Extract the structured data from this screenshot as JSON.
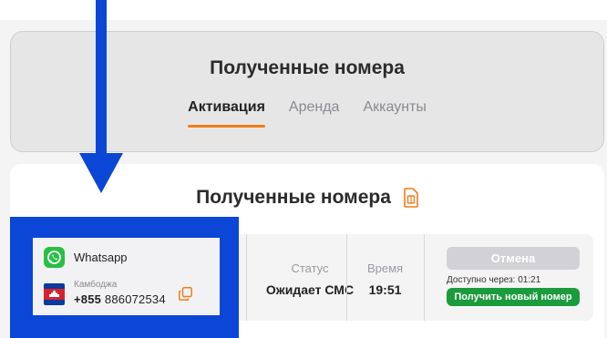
{
  "header": {
    "title": "Полученные номера",
    "tabs": [
      {
        "label": "Активация",
        "active": true
      },
      {
        "label": "Аренда",
        "active": false
      },
      {
        "label": "Аккаунты",
        "active": false
      }
    ]
  },
  "section": {
    "title": "Полученные номера",
    "icon": "sim-card-icon"
  },
  "order": {
    "service": "Whatsapp",
    "country": "Камбоджа",
    "phone_prefix": "+855",
    "phone_number": "886072534",
    "status_label": "Статус",
    "status_value": "Ожидает СМС",
    "time_label": "Время",
    "time_value": "19:51",
    "cancel_label": "Отмена",
    "available_text": "Доступно через:",
    "available_time": "01:21",
    "new_number_label": "Получить новый номер"
  },
  "colors": {
    "accent": "#f07d1a",
    "highlight": "#0b46d6",
    "green": "#1c9b3c",
    "whatsapp": "#27c044"
  }
}
